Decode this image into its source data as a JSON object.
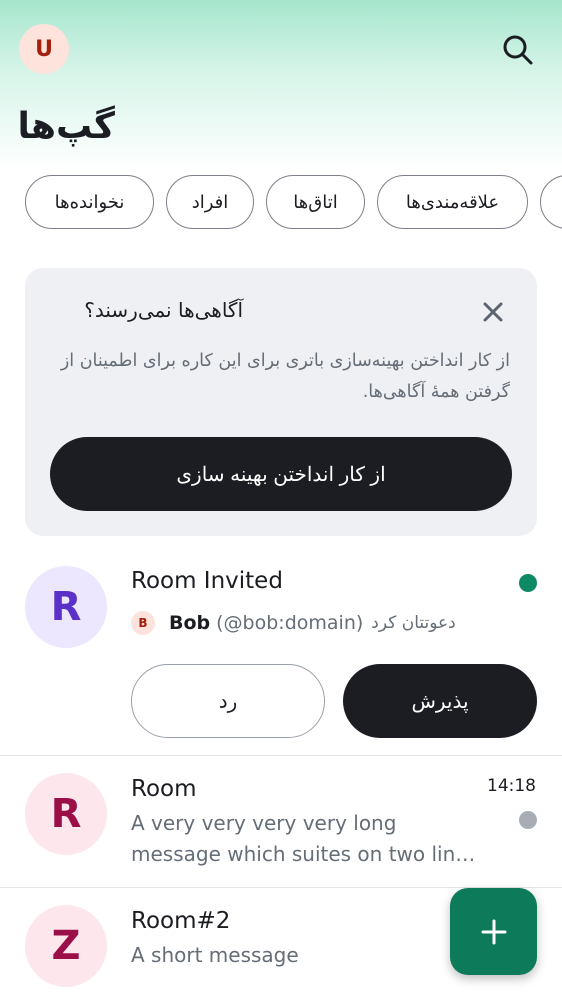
{
  "header": {
    "user_avatar_letter": "U",
    "title": "گپ‌ها"
  },
  "filters": [
    "نخوانده‌ها",
    "افراد",
    "اتاق‌ها",
    "علاقه‌مندی‌ها",
    ""
  ],
  "banner": {
    "title": "آگاهی‌ها نمی‌رسند؟",
    "body": "از کار انداختن بهینه‌سازی باتری برای این کاره برای اطمینان از گرفتن همهٔ آگاهی‌ها.",
    "button_label": "از کار انداختن بهینه سازی"
  },
  "rooms": [
    {
      "avatar_letter": "R",
      "name": "Room Invited",
      "inviter_avatar_letter": "B",
      "inviter_name": "Bob",
      "inviter_id": "(@bob:domain)",
      "invite_text": "دعوتتان کرد",
      "accept_label": "پذیرش",
      "reject_label": "رد",
      "status_color": "#0d8a63"
    },
    {
      "avatar_letter": "R",
      "name": "Room",
      "time": "14:18",
      "message": "A very very very very long message which suites on two lin…",
      "status_color": "#a8adb5"
    },
    {
      "avatar_letter": "Z",
      "name": "Room#2",
      "message": "A short message"
    }
  ],
  "fab": {
    "icon": "plus-icon"
  },
  "colors": {
    "accent": "#0d7a5a",
    "avatar_purple_bg": "#ede6ff",
    "avatar_purple_fg": "#5a30c9",
    "avatar_pink_bg": "#fde6ec",
    "avatar_pink_fg": "#9b0f49"
  }
}
